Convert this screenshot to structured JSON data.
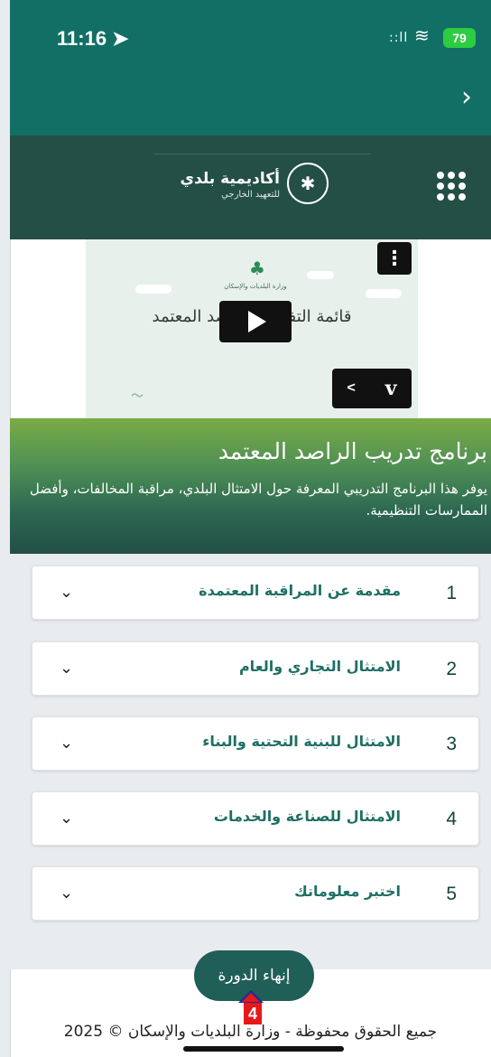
{
  "status_bar": {
    "time": "11:16 ➤",
    "signal": "::ll",
    "wifi_icon": "wifi-icon",
    "battery": "79"
  },
  "nav": {
    "back_icon": "›"
  },
  "header": {
    "brand_name": "أكاديمية بلدي",
    "brand_sub": "للتعهيد الخارجي",
    "emblem_icon": "palm-emblem-icon",
    "menu_icon": "grid-menu-icon"
  },
  "video": {
    "title_text": "قائمة التفحص للراصد المعتمد",
    "ministry_mark": "♣",
    "ministry_text": "وزارة البلديات والإسكان",
    "more_icon": "⋮",
    "vimeo_prev": "<",
    "vimeo_logo": "v"
  },
  "banner": {
    "title": "برنامج تدريب الراصد المعتمد",
    "description": "يوفر هذا البرنامج التدريبي المعرفة حول الامتثال البلدي، مراقبة المخالفات، وأفضل الممارسات التنظيمية."
  },
  "modules": [
    {
      "number": "1",
      "title": "مقدمة عن المراقبة المعتمدة"
    },
    {
      "number": "2",
      "title": "الامتثال التجاري والعام"
    },
    {
      "number": "3",
      "title": "الامتثال للبنية التحتية والبناء"
    },
    {
      "number": "4",
      "title": "الامتثال للصناعة والخدمات"
    },
    {
      "number": "5",
      "title": "اختبر معلوماتك"
    }
  ],
  "chevron": "⌄",
  "finish_button": "إنهاء الدورة",
  "marker_label": "4",
  "footer": "جميع الحقوق محفوظة - وزارة البلديات والإسكان © 2025"
}
